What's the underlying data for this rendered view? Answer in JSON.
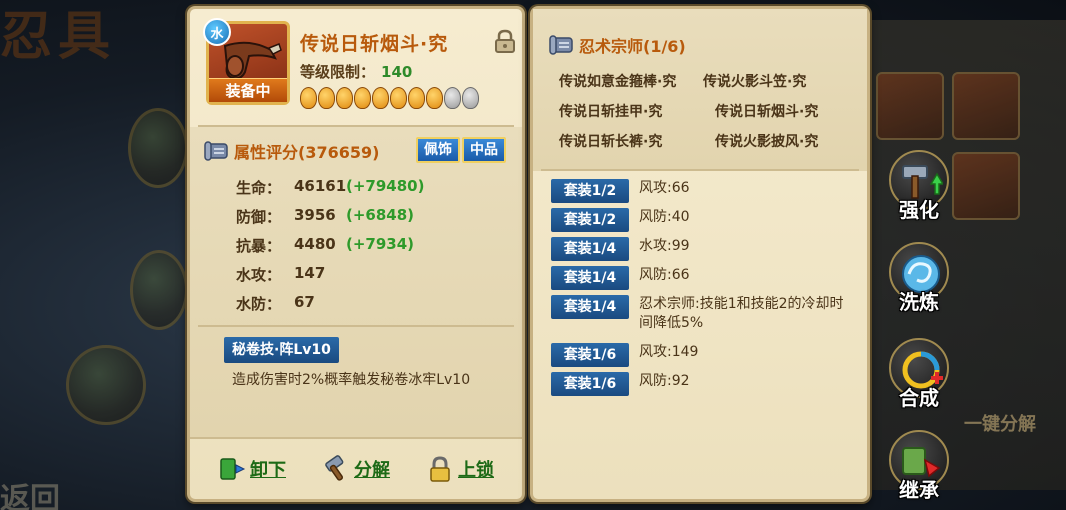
{
  "background": {
    "title": "忍具",
    "bottom_text": "返回",
    "right_label": "一键分解"
  },
  "item": {
    "element_badge": "水",
    "equipped_label": "装备中",
    "name": "传说日斩烟斗·究",
    "level_label": "等级限制：",
    "level_value": "140",
    "stars_filled": 8,
    "stars_total": 10
  },
  "attributes": {
    "score_label": "属性评分(376659)",
    "tag_type": "佩饰",
    "tag_grade": "中品",
    "stats": [
      {
        "label": "生命：",
        "value": "46161",
        "bonus": "(+79480)"
      },
      {
        "label": "防御：",
        "value": "3956",
        "bonus": "(+6848)"
      },
      {
        "label": "抗暴：",
        "value": "4480",
        "bonus": "(+7934)"
      },
      {
        "label": "水攻：",
        "value": "147",
        "bonus": ""
      },
      {
        "label": "水防：",
        "value": "67",
        "bonus": ""
      }
    ],
    "skill_name": "秘卷技·阵Lv10",
    "skill_desc": "造成伤害时2%概率触发秘卷冰牢Lv10"
  },
  "actions": {
    "unequip": "卸下",
    "decompose": "分解",
    "lock": "上锁"
  },
  "set": {
    "title": "忍术宗师(1/6)",
    "items": [
      "传说如意金箍棒·究",
      "传说火影斗笠·究",
      "传说日斩挂甲·究",
      "传说日斩烟斗·究",
      "传说日斩长裤·究",
      "传说火影披风·究"
    ],
    "bonuses": [
      {
        "tag": "套装1/2",
        "text": "风攻:66"
      },
      {
        "tag": "套装1/2",
        "text": "风防:40"
      },
      {
        "tag": "套装1/4",
        "text": "水攻:99"
      },
      {
        "tag": "套装1/4",
        "text": "风防:66"
      },
      {
        "tag": "套装1/4",
        "text": "忍术宗师:技能1和技能2的冷却时间降低5%"
      },
      {
        "tag": "套装1/6",
        "text": "风攻:149"
      },
      {
        "tag": "套装1/6",
        "text": "风防:92"
      }
    ]
  },
  "side_buttons": {
    "enhance": "强化",
    "refine": "洗炼",
    "synthesize": "合成",
    "inherit": "继承"
  },
  "colors": {
    "panel_bg": "#f3e8ca",
    "title_orange": "#b85a0c",
    "bonus_green": "#2e9a2a",
    "tag_blue": "#1a5aa8"
  }
}
